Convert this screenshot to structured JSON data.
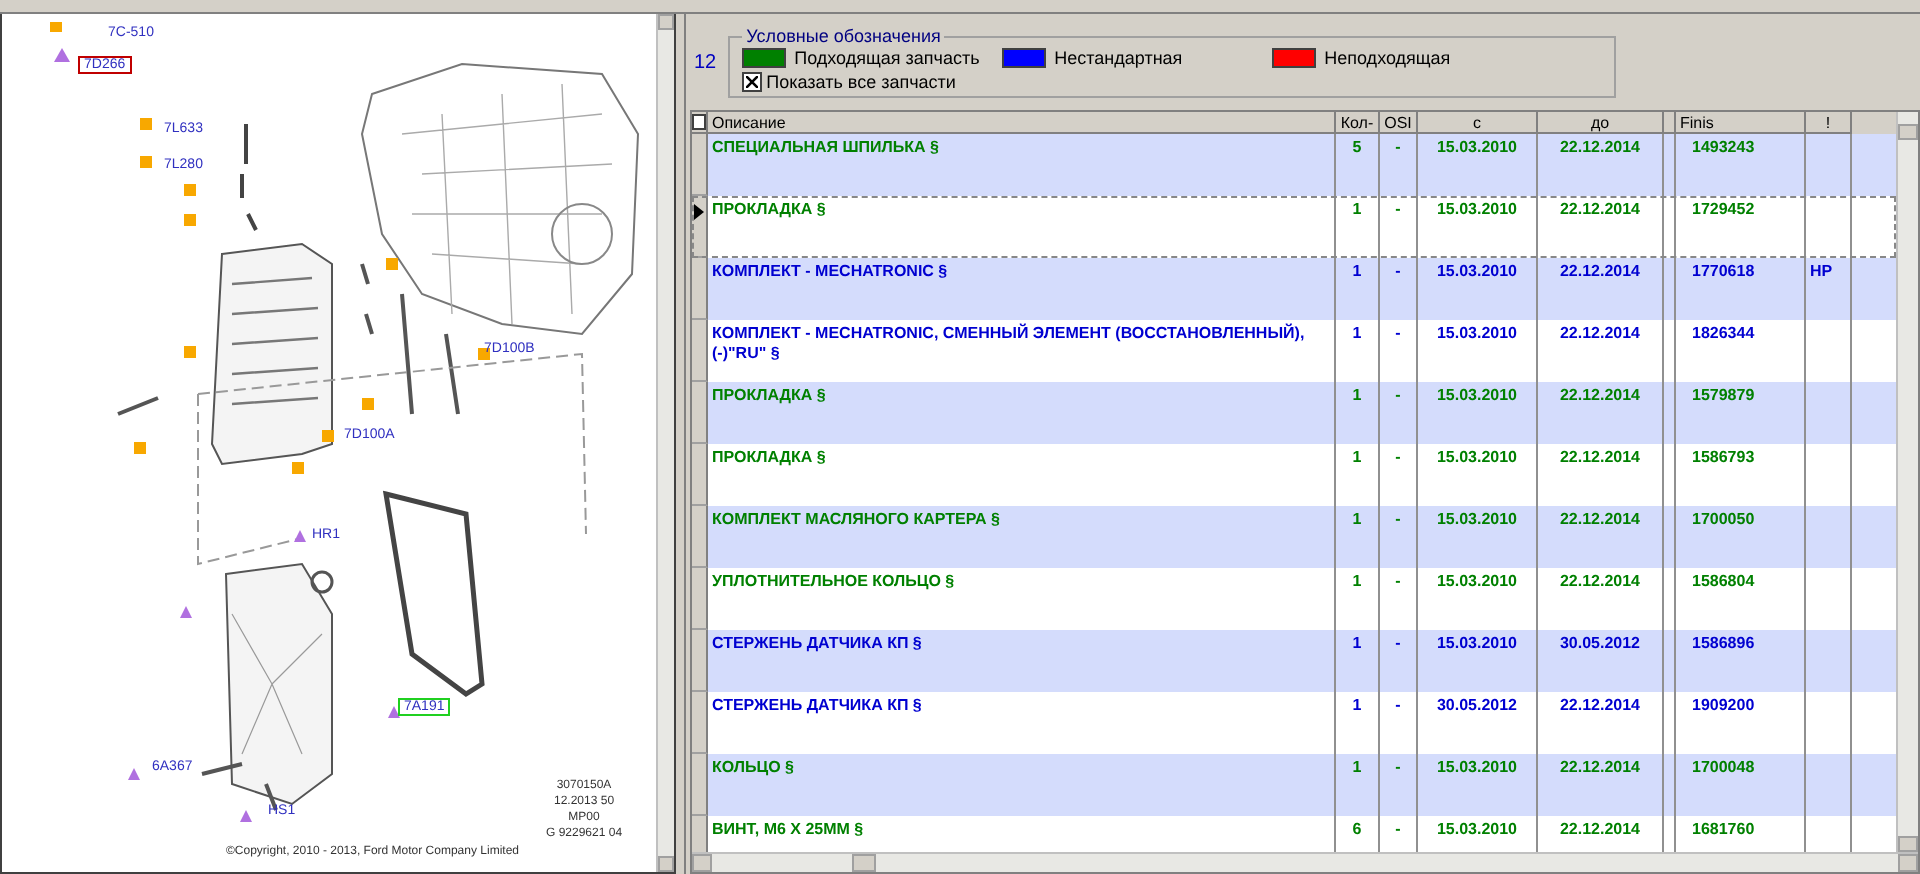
{
  "diagram": {
    "callouts": [
      {
        "text": "7C-510"
      },
      {
        "text": "7D266",
        "color": "#c00000"
      },
      {
        "text": "7L633"
      },
      {
        "text": "7L280"
      },
      {
        "text": "7D100B"
      },
      {
        "text": "7D100A"
      },
      {
        "text": "HR1"
      },
      {
        "text": "7A191",
        "color": "#20d020"
      },
      {
        "text": "6A367"
      },
      {
        "text": "HS1"
      }
    ],
    "stamp": [
      "3070150A",
      "12.2013 50",
      "MP00",
      "G 9229621 04"
    ],
    "copyright": "©Copyright, 2010 - 2013, Ford Motor Company Limited"
  },
  "count": "12",
  "legend": {
    "title": "Условные обозначения",
    "items": [
      {
        "label": "Подходящая запчасть",
        "color": "#008000"
      },
      {
        "label": "Нестандартная",
        "color": "#0000ff"
      },
      {
        "label": "Неподходящая",
        "color": "#ff0000"
      }
    ],
    "show_all": {
      "label": "Показать все запчасти",
      "checked": true
    }
  },
  "table": {
    "select_all_checked": false,
    "columns": [
      "Описание",
      "Кол-",
      "OSI",
      "с",
      "до",
      "Finis",
      "!"
    ],
    "rows": [
      {
        "kind": "suitable",
        "selected": false,
        "cells": [
          "СПЕЦИАЛЬНАЯ ШПИЛЬКА §",
          "5",
          "-",
          "15.03.2010",
          "22.12.2014",
          "1493243",
          ""
        ]
      },
      {
        "kind": "suitable",
        "selected": true,
        "cells": [
          "ПРОКЛАДКА §",
          "1",
          "-",
          "15.03.2010",
          "22.12.2014",
          "1729452",
          ""
        ]
      },
      {
        "kind": "nonstandard",
        "selected": false,
        "cells": [
          "КОМПЛЕКТ - MECHATRONIC §",
          "1",
          "-",
          "15.03.2010",
          "22.12.2014",
          "1770618",
          "HP"
        ]
      },
      {
        "kind": "nonstandard",
        "selected": false,
        "cells": [
          "КОМПЛЕКТ - MECHATRONIC, СМЕННЫЙ ЭЛЕМЕНТ (ВОССТАНОВЛЕННЫЙ), (-)\"RU\" §",
          "1",
          "-",
          "15.03.2010",
          "22.12.2014",
          "1826344",
          ""
        ]
      },
      {
        "kind": "suitable",
        "selected": false,
        "cells": [
          "ПРОКЛАДКА §",
          "1",
          "-",
          "15.03.2010",
          "22.12.2014",
          "1579879",
          ""
        ]
      },
      {
        "kind": "suitable",
        "selected": false,
        "cells": [
          "ПРОКЛАДКА §",
          "1",
          "-",
          "15.03.2010",
          "22.12.2014",
          "1586793",
          ""
        ]
      },
      {
        "kind": "suitable",
        "selected": false,
        "cells": [
          "КОМПЛЕКТ МАСЛЯНОГО КАРТЕРА §",
          "1",
          "-",
          "15.03.2010",
          "22.12.2014",
          "1700050",
          ""
        ]
      },
      {
        "kind": "suitable",
        "selected": false,
        "cells": [
          "УПЛОТНИТЕЛЬНОЕ КОЛЬЦО §",
          "1",
          "-",
          "15.03.2010",
          "22.12.2014",
          "1586804",
          ""
        ]
      },
      {
        "kind": "nonstandard",
        "selected": false,
        "cells": [
          "СТЕРЖЕНЬ ДАТЧИКА КП §",
          "1",
          "-",
          "15.03.2010",
          "30.05.2012",
          "1586896",
          ""
        ]
      },
      {
        "kind": "nonstandard",
        "selected": false,
        "cells": [
          "СТЕРЖЕНЬ ДАТЧИКА КП §",
          "1",
          "-",
          "30.05.2012",
          "22.12.2014",
          "1909200",
          ""
        ]
      },
      {
        "kind": "suitable",
        "selected": false,
        "cells": [
          "КОЛЬЦО §",
          "1",
          "-",
          "15.03.2010",
          "22.12.2014",
          "1700048",
          ""
        ]
      },
      {
        "kind": "suitable",
        "selected": false,
        "cells": [
          "ВИНТ, М6 X 25ММ §",
          "6",
          "-",
          "15.03.2010",
          "22.12.2014",
          "1681760",
          ""
        ]
      }
    ]
  }
}
